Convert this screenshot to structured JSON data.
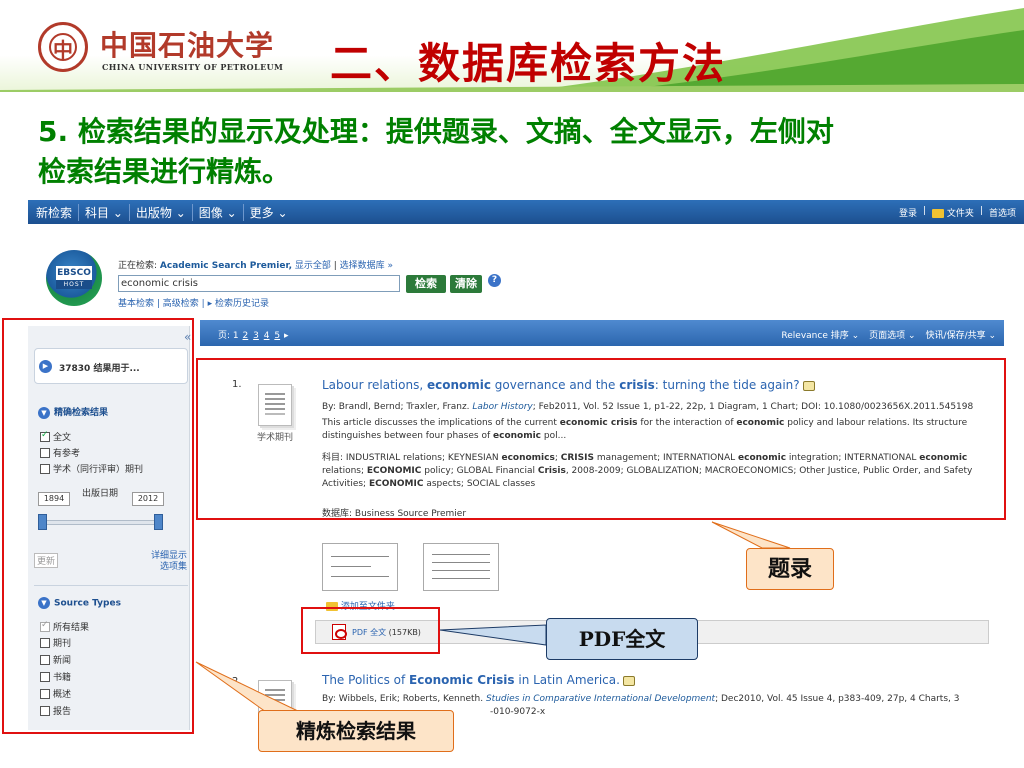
{
  "header": {
    "university_cn": "中国石油大学",
    "university_en": "CHINA UNIVERSITY OF PETROLEUM",
    "title": "二、数据库检索方法"
  },
  "subtitle": {
    "line1": "5. 检索结果的显示及处理：提供题录、文摘、全文显示，左侧对",
    "line2": "检索结果进行精炼。"
  },
  "topnav": {
    "items": [
      "新检索",
      "科目 ⌄",
      "出版物 ⌄",
      "图像 ⌄",
      "更多 ⌄"
    ],
    "login": "登录",
    "folder": "文件夹",
    "prefs": "首选项"
  },
  "search": {
    "logo_word": "EBSCO",
    "logo_host": "HOST",
    "searching_label": "正在检索:",
    "database": "Academic Search Premier,",
    "show_all": "显示全部",
    "choose_db": "选择数据库 »",
    "query": "economic crisis",
    "search_button": "检索",
    "clear_button": "清除",
    "help": "?",
    "basic": "基本检索",
    "advanced": "高级检索",
    "history": "▸ 检索历史记录"
  },
  "results_bar": {
    "pages_label": "页:",
    "pages": [
      "1",
      "2",
      "3",
      "4",
      "5"
    ],
    "next": "▸",
    "sort": "Relevance 排序 ⌄",
    "page_options": "页面选项 ⌄",
    "share": "快讯/保存/共享 ⌄"
  },
  "sidebar": {
    "collapse": "«",
    "result_count": "37830 结果用于...",
    "refine_header": "精确检索结果",
    "refine_items": [
      {
        "label": "全文",
        "checked": true
      },
      {
        "label": "有参考",
        "checked": false
      },
      {
        "label": "学术（同行评审）期刊",
        "checked": false
      }
    ],
    "year_from": "1894",
    "year_to": "2012",
    "pub_date": "出版日期",
    "update": "更新",
    "detail_line1": "详细显示",
    "detail_line2": "选项集",
    "source_header": "Source Types",
    "source_items": [
      {
        "label": "所有结果",
        "checked": true,
        "grey": true
      },
      {
        "label": "期刊",
        "checked": false
      },
      {
        "label": "新闻",
        "checked": false
      },
      {
        "label": "书籍",
        "checked": false
      },
      {
        "label": "概述",
        "checked": false
      },
      {
        "label": "报告",
        "checked": false
      }
    ]
  },
  "result1": {
    "number": "1.",
    "doc_type": "学术期刊",
    "title_a": "Labour relations, ",
    "title_b": "economic",
    "title_c": " governance and the ",
    "title_d": "crisis",
    "title_e": ": turning the tide again?",
    "meta_a": "By: Brandl, Bernd; Traxler, Franz. ",
    "meta_src": "Labor History",
    "meta_b": "; Feb2011, Vol. 52 Issue 1, p1-22, 22p, 1 Diagram, 1 Chart; DOI: 10.1080/0023656X.2011.545198",
    "abstract_a": "This article discusses the implications of the current ",
    "abstract_b": "economic crisis",
    "abstract_c": " for the interaction of ",
    "abstract_d": "economic",
    "abstract_e": " policy and labour relations. Its structure distinguishes between four phases of ",
    "abstract_f": "economic",
    "abstract_g": " pol...",
    "subjects_label": "科目: ",
    "subjects_a": "INDUSTRIAL relations; KEYNESIAN ",
    "subjects_b": "economics",
    "subjects_c": "; ",
    "subjects_d": "CRISIS",
    "subjects_e": " management; INTERNATIONAL ",
    "subjects_f": "economic",
    "subjects_g": " integration; INTERNATIONAL ",
    "subjects_h": "economic",
    "subjects_i": " relations; ",
    "subjects_j": "ECONOMIC",
    "subjects_k": " policy; GLOBAL Financial ",
    "subjects_l": "Crisis",
    "subjects_m": ", 2008-2009; GLOBALIZATION; MACROECONOMICS; Other Justice, Public Order, and Safety Activities; ",
    "subjects_n": "ECONOMIC",
    "subjects_o": " aspects; SOCIAL classes",
    "database_label": "数据库: ",
    "database": "Business Source Premier",
    "add_folder": "添加至文件夹",
    "pdf_label": "PDF 全文",
    "pdf_size": " (157KB)"
  },
  "result2": {
    "number": "2.",
    "title_a": "The Politics of ",
    "title_b": "Economic Crisis",
    "title_c": " in Latin America.",
    "meta_a": "By: Wibbels, Erik; Roberts, Kenneth. ",
    "meta_src": "Studies in Comparative International Development",
    "meta_b": "; Dec2010, Vol. 45 Issue 4, p383-409, 27p, 4 Charts, 3",
    "meta_c": "-010-9072-x"
  },
  "callouts": {
    "record": "题录",
    "pdf": "PDF全文",
    "refine": "精炼检索结果"
  },
  "colors": {
    "title_red": "#c00000",
    "subtitle_green": "#008000",
    "annotation_red": "#e01010",
    "ebsco_blue": "#2c66ae"
  }
}
